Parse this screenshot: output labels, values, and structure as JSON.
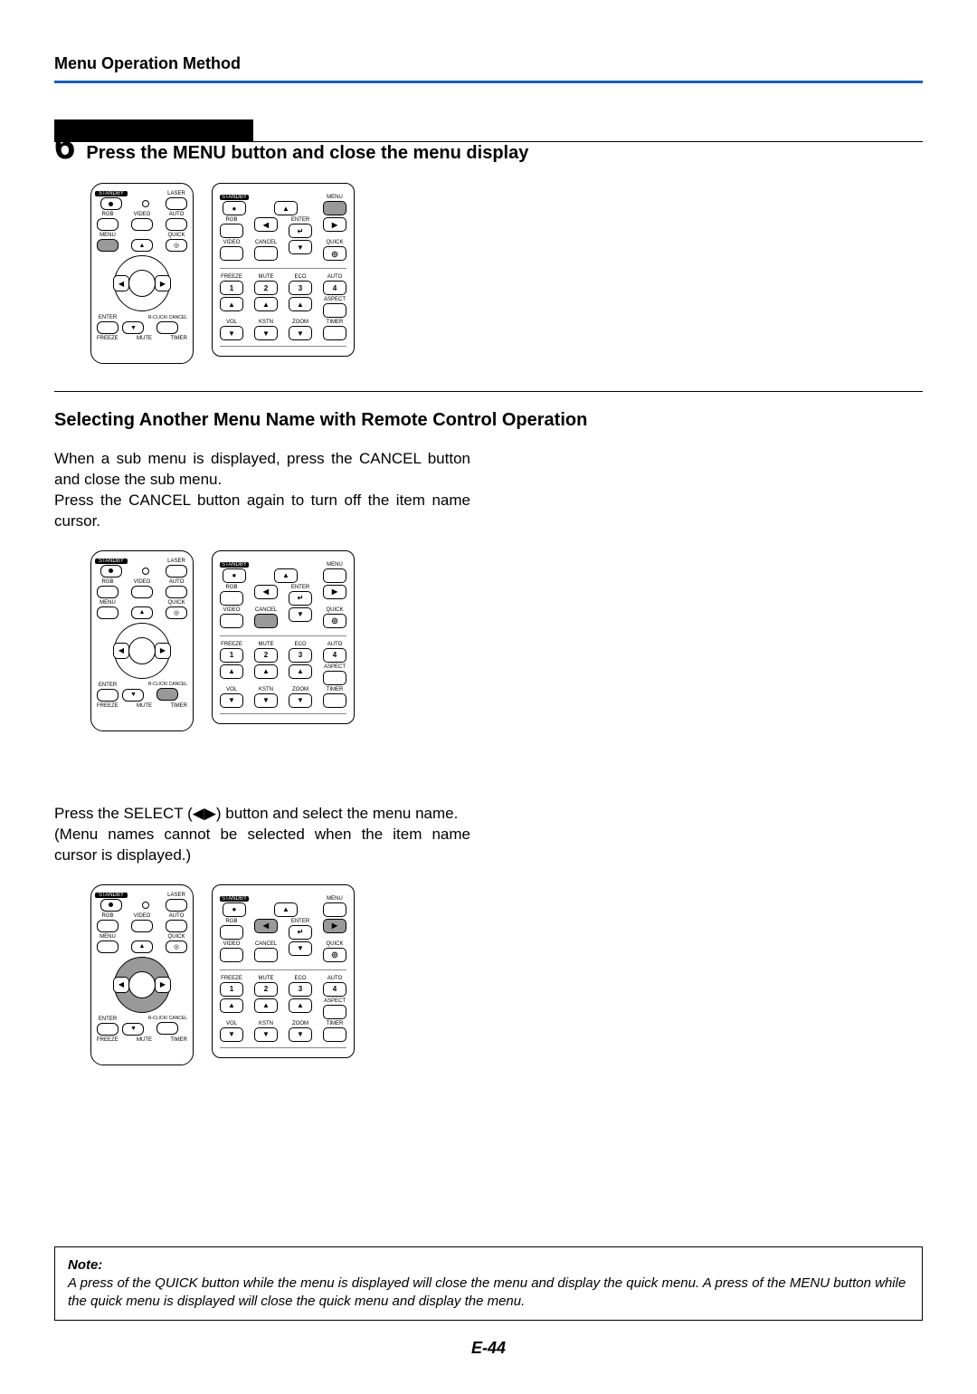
{
  "header": {
    "title": "Menu Operation Method"
  },
  "step": {
    "number": "6",
    "text": "Press the MENU button and close the menu display"
  },
  "remote_a_labels": {
    "standby": "STANDBY",
    "laser": "LASER",
    "rgb": "RGB",
    "video": "VIDEO",
    "auto": "AUTO",
    "menu": "MENU",
    "quick": "QUICK",
    "enter": "ENTER",
    "rclick_cancel": "R-CLICK/\nCANCEL",
    "freeze": "FREEZE",
    "mute": "MUTE",
    "timer": "TIMER"
  },
  "remote_b_labels": {
    "standby": "STANDBY",
    "menu": "MENU",
    "rgb": "RGB",
    "enter": "ENTER",
    "video": "VIDEO",
    "cancel": "CANCEL",
    "quick": "QUICK",
    "freeze": "FREEZE",
    "mute": "MUTE",
    "eco": "ECO",
    "auto": "AUTO",
    "aspect": "ASPECT",
    "vol": "VOL",
    "kstn": "KSTN",
    "zoom": "ZOOM",
    "timer": "TIMER",
    "n1": "1",
    "n2": "2",
    "n3": "3",
    "n4": "4"
  },
  "section2": {
    "heading": "Selecting Another Menu Name with Remote Control Operation",
    "para1": "When a sub menu is displayed, press the CANCEL button and close the sub menu.\nPress the CANCEL button again to turn off the item name cursor.",
    "para2_a": "Press the SELECT (",
    "para2_arrows": "◀▶",
    "para2_b": ") button and select the menu name.",
    "para2_c": "(Menu names cannot be selected when the item name cursor is displayed.)"
  },
  "note": {
    "label": "Note:",
    "text": "A press of the QUICK button while the menu is displayed will close the menu and display the quick menu. A press of the MENU button while the quick menu is displayed will close the quick menu and display the menu."
  },
  "page_number": "E-44"
}
